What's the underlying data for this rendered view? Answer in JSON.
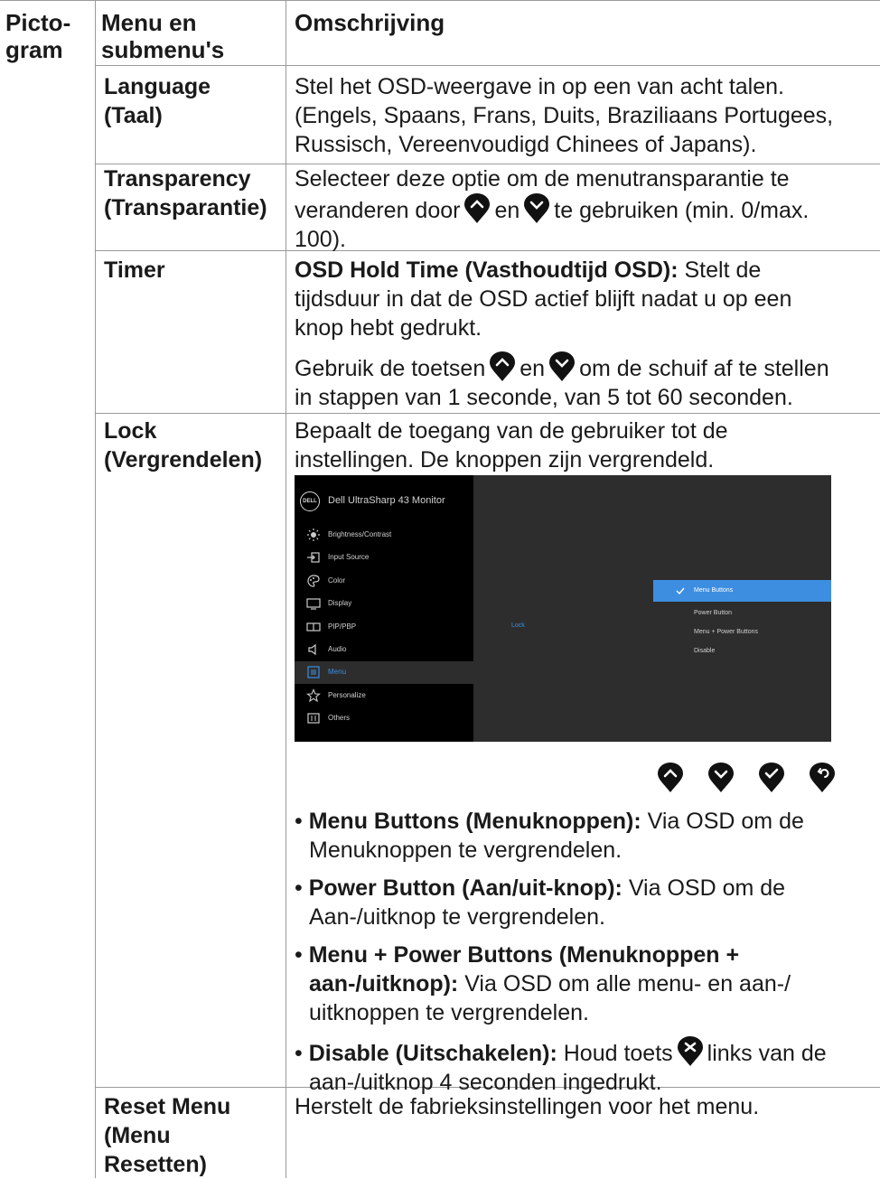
{
  "headers": {
    "pictogram_1": "Picto-",
    "pictogram_2": "gram",
    "menu_1": "Menu en",
    "menu_2": "submenu's",
    "description": "Omschrijving"
  },
  "rows": {
    "language": {
      "name_1": "Language",
      "name_2": "(Taal)",
      "desc_1": "Stel het OSD-weergave in op een van acht talen.",
      "desc_2": "(Engels, Spaans, Frans, Duits, Braziliaans Portugees,",
      "desc_3": "Russisch, Vereenvoudigd Chinees of Japans)."
    },
    "transparency": {
      "name_1": "Transparency",
      "name_2": "(Transparantie)",
      "desc_1": "Selecteer deze optie om de menutransparantie te",
      "desc_2a": "veranderen door",
      "desc_2b": "en",
      "desc_2c": "te gebruiken (min. 0/max.",
      "desc_3": "100)."
    },
    "timer": {
      "name": "Timer",
      "p1_bold": "OSD Hold Time (Vasthoudtijd OSD):",
      "p1_rest": " Stelt de",
      "p1_2": "tijdsduur in dat de OSD actief blijft nadat u op een",
      "p1_3": "knop hebt gedrukt.",
      "p2_a": "Gebruik de toetsen",
      "p2_b": "en",
      "p2_c": "om de schuif af te stellen",
      "p2_2": "in stappen van 1 seconde, van 5 tot 60 seconden."
    },
    "lock": {
      "name_1": "Lock",
      "name_2": "(Vergrendelen)",
      "desc_1": "Bepaalt de toegang van de gebruiker tot de",
      "desc_2": "instellingen. De knoppen zijn vergrendeld."
    },
    "reset": {
      "name_1": "Reset Menu",
      "name_2": "(Menu",
      "name_3": "Resetten)",
      "desc": "Herstelt de fabrieksinstellingen voor het menu."
    }
  },
  "osd": {
    "title": "Dell UltraSharp 43 Monitor",
    "logo": "DELL",
    "menu": [
      "Brightness/Contrast",
      "Input Source",
      "Color",
      "Display",
      "PIP/PBP",
      "Audio",
      "Menu",
      "Personalize",
      "Others"
    ],
    "menu_icons": [
      "brightness-icon",
      "input-source-icon",
      "color-icon",
      "display-icon",
      "pip-pbp-icon",
      "audio-icon",
      "menu-icon",
      "personalize-icon",
      "others-icon"
    ],
    "selected_menu": "Menu",
    "sub_label": "Lock",
    "options": [
      "Menu Buttons",
      "Power Button",
      "Menu + Power Buttons",
      "Disable"
    ],
    "selected_option": "Menu Buttons",
    "accent": "#3d8ee0"
  },
  "buttons": [
    "up-button-icon",
    "down-button-icon",
    "confirm-button-icon",
    "back-button-icon"
  ],
  "bullets": {
    "b1_bold": "Menu Buttons (Menuknoppen):",
    "b1_rest": " Via OSD om de",
    "b1_2": "Menuknoppen te vergrendelen.",
    "b2_bold": "Power Button (Aan/uit-knop):",
    "b2_rest": " Via OSD om de",
    "b2_2": "Aan-/uitknop te vergrendelen.",
    "b3_bold": "Menu + Power Buttons (Menuknoppen +",
    "b3_bold2": "aan-/uitknop):",
    "b3_rest": " Via OSD om alle menu- en aan-/",
    "b3_3": "uitknoppen te vergrendelen.",
    "b4_bold": "Disable (Uitschakelen):",
    "b4_a": " Houd toets",
    "b4_b": "links van de",
    "b4_2": "aan-/uitknop 4 seconden ingedrukt."
  }
}
